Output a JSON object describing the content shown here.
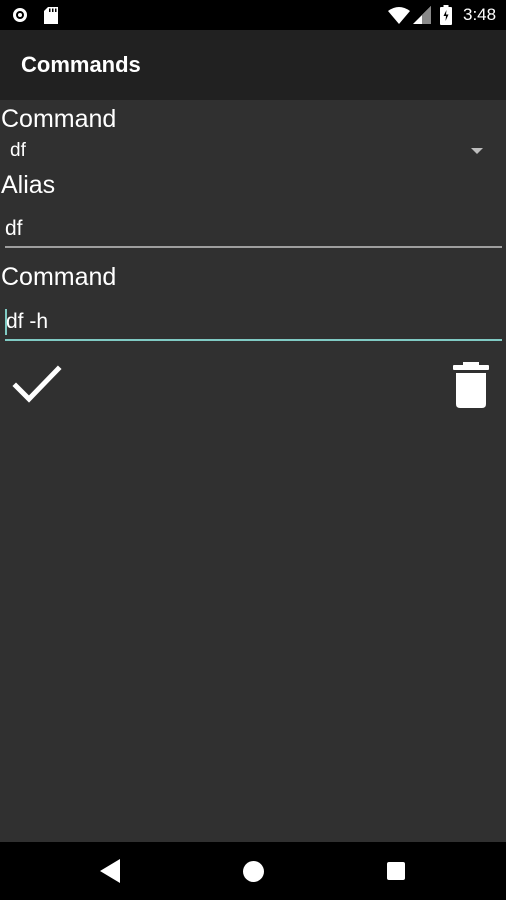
{
  "status_bar": {
    "time": "3:48",
    "icons": [
      "notification-circle-icon",
      "sd-card-icon",
      "wifi-icon",
      "cell-signal-icon",
      "battery-icon"
    ]
  },
  "toolbar": {
    "title": "Commands"
  },
  "form": {
    "command_spinner": {
      "label": "Command",
      "selected_value": "df"
    },
    "alias": {
      "label": "Alias",
      "value": "df"
    },
    "command": {
      "label": "Command",
      "value": "df -h"
    }
  },
  "actions": {
    "confirm_icon": "checkmark-icon",
    "delete_icon": "trash-icon"
  },
  "nav_bar": {
    "icons": [
      "back-icon",
      "home-icon",
      "recents-icon"
    ]
  },
  "colors": {
    "background": "#303030",
    "toolbar": "#212121",
    "accent": "#80cbc4",
    "text": "#ffffff",
    "underline_inactive": "#9e9e9e"
  }
}
